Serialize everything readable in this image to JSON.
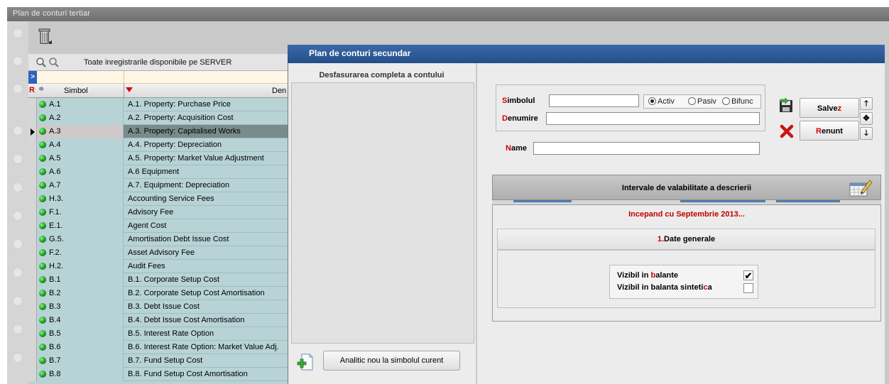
{
  "outer_window": {
    "title": "Plan de conturi tertiar"
  },
  "search": {
    "label": "Toate inregistrarile disponibile pe SERVER"
  },
  "grid": {
    "headers": {
      "r": "R",
      "sort": "≑",
      "simbol": "Simbol",
      "denumire": "Den"
    },
    "rows": [
      {
        "simbol": "A.1",
        "denumire": "A.1. Property: Purchase Price"
      },
      {
        "simbol": "A.2",
        "denumire": "A.2. Property: Acquisition Cost"
      },
      {
        "simbol": "A.3",
        "denumire": "A.3. Property: Capitalised Works",
        "selected": true
      },
      {
        "simbol": "A.4",
        "denumire": "A.4. Property: Depreciation"
      },
      {
        "simbol": "A.5",
        "denumire": "A.5. Property: Market Value Adjustment"
      },
      {
        "simbol": "A.6",
        "denumire": "A.6 Equipment"
      },
      {
        "simbol": "A.7",
        "denumire": "A.7. Equipment: Depreciation"
      },
      {
        "simbol": "H.3.",
        "denumire": "Accounting Service Fees"
      },
      {
        "simbol": "F.1.",
        "denumire": "Advisory Fee"
      },
      {
        "simbol": "E.1.",
        "denumire": "Agent Cost"
      },
      {
        "simbol": "G.5.",
        "denumire": "Amortisation Debt Issue Cost"
      },
      {
        "simbol": "F.2.",
        "denumire": "Asset Advisory Fee"
      },
      {
        "simbol": "H.2.",
        "denumire": "Audit  Fees"
      },
      {
        "simbol": "B.1",
        "denumire": "B.1. Corporate Setup Cost"
      },
      {
        "simbol": "B.2",
        "denumire": "B.2. Corporate Setup Cost Amortisation"
      },
      {
        "simbol": "B.3",
        "denumire": "B.3. Debt Issue Cost"
      },
      {
        "simbol": "B.4",
        "denumire": "B.4. Debt Issue Cost Amortisation"
      },
      {
        "simbol": "B.5",
        "denumire": "B.5. Interest Rate Option"
      },
      {
        "simbol": "B.6",
        "denumire": "B.6. Interest Rate Option: Market Value Adj."
      },
      {
        "simbol": "B.7",
        "denumire": "B.7. Fund Setup Cost"
      },
      {
        "simbol": "B.8",
        "denumire": "B.8. Fund Setup Cost Amortisation"
      }
    ]
  },
  "dialog": {
    "title": "Plan de conturi secundar",
    "tree_header": "Desfasurarea completa a contului",
    "analitic_button": "Analitic nou la simbolul curent",
    "form": {
      "simbol_label_first": "S",
      "simbol_label_rest": "imbolul",
      "simbol_value": "",
      "denumire_label_first": "D",
      "denumire_label_rest": "enumire",
      "denumire_value": "",
      "name_label_first": "N",
      "name_label_rest": "ame",
      "name_value": "",
      "radio_options": [
        "Activ",
        "Pasiv",
        "Bifunc"
      ],
      "radio_selected": "Activ"
    },
    "buttons": {
      "save_main": "Salve",
      "save_hot": "z",
      "cancel_hot": "R",
      "cancel_main": "enunt"
    },
    "validity": {
      "header": "Intervale de valabilitate a descrierii",
      "since": "Incepand cu Septembrie 2013...",
      "section_num": "1.",
      "section_title": "Date generale",
      "chk1_a": "Vizibil in ",
      "chk1_hot": "b",
      "chk1_b": "alante",
      "chk1_checked": true,
      "chk2_a": "Vizibil in balanta sinteti",
      "chk2_hot": "c",
      "chk2_b": "a",
      "chk2_checked": false
    }
  },
  "colors": {
    "accent_red": "#d00000",
    "dialog_title_blue": "#2f5c98",
    "grid_row": "#b8d3d6",
    "status_green": "#1b9a1b"
  }
}
